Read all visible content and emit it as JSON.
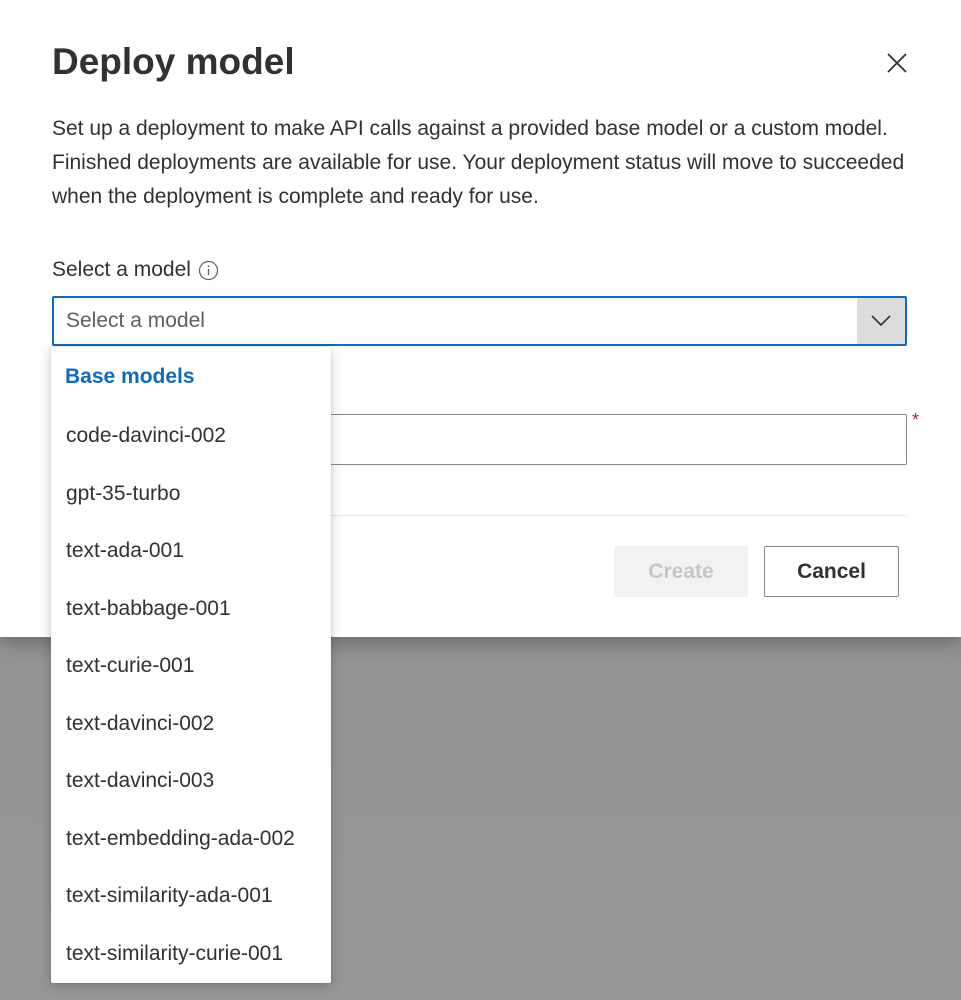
{
  "dialog": {
    "title": "Deploy model",
    "description": "Set up a deployment to make API calls against a provided base model or a custom model. Finished deployments are available for use. Your deployment status will move to succeeded when the deployment is complete and ready for use.",
    "model_field": {
      "label": "Select a model",
      "placeholder": "Select a model"
    },
    "deployment_name_field": {
      "value": "",
      "required_marker": "*"
    },
    "buttons": {
      "create": "Create",
      "cancel": "Cancel"
    }
  },
  "dropdown": {
    "group_header": "Base models",
    "options": [
      "code-davinci-002",
      "gpt-35-turbo",
      "text-ada-001",
      "text-babbage-001",
      "text-curie-001",
      "text-davinci-002",
      "text-davinci-003",
      "text-embedding-ada-002",
      "text-similarity-ada-001",
      "text-similarity-curie-001"
    ]
  },
  "icons": {
    "close": "close-icon",
    "info": "info-icon",
    "chevron": "chevron-down-icon"
  },
  "colors": {
    "accent": "#0f6cbd",
    "required": "#a4262c",
    "overlay": "#929292"
  }
}
